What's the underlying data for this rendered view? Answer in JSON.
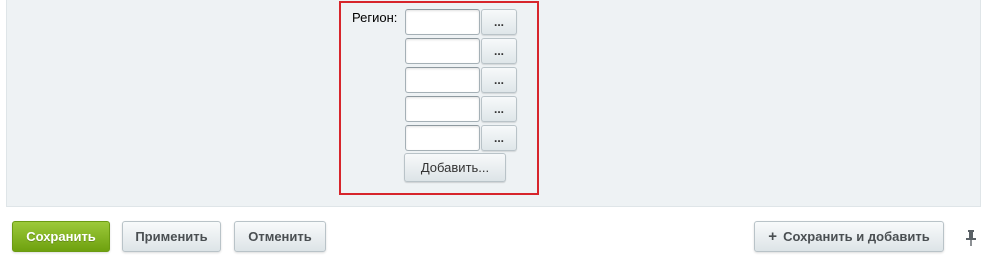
{
  "region": {
    "label": "Регион:",
    "rows": [
      {
        "value": "",
        "picker_label": "..."
      },
      {
        "value": "",
        "picker_label": "..."
      },
      {
        "value": "",
        "picker_label": "..."
      },
      {
        "value": "",
        "picker_label": "..."
      },
      {
        "value": "",
        "picker_label": "..."
      }
    ],
    "add_label": "Добавить..."
  },
  "footer": {
    "save_label": "Сохранить",
    "apply_label": "Применить",
    "cancel_label": "Отменить",
    "save_add_label": "Сохранить и добавить"
  },
  "icons": {
    "plus": "plus-icon",
    "pin": "pin-icon"
  },
  "colors": {
    "primary": "#7cb01a",
    "highlight_border": "#d7252b",
    "panel_bg": "#eef2f4"
  }
}
